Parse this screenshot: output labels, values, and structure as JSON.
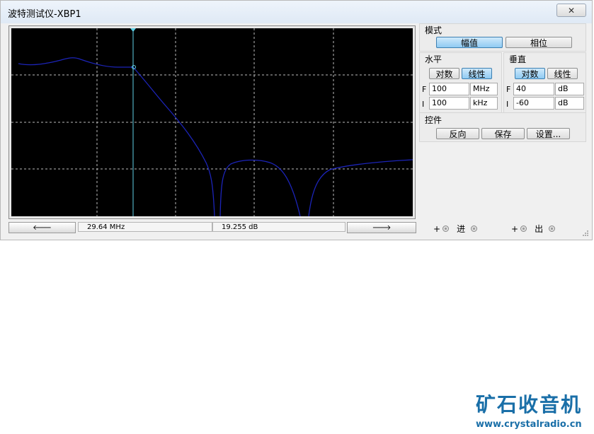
{
  "window": {
    "title": "波特测试仪-XBP1",
    "close_label": "✕"
  },
  "readout": {
    "frequency": "29.64 MHz",
    "magnitude": "19.255 dB",
    "left_arrow": "🡐",
    "right_arrow": "🡒"
  },
  "mode": {
    "header": "模式",
    "magnitude_label": "幅值",
    "phase_label": "相位",
    "active": "magnitude"
  },
  "horizontal": {
    "header": "水平",
    "log_label": "对数",
    "lin_label": "线性",
    "active": "lin",
    "final_label": "F",
    "final_value": "100",
    "final_unit": "MHz",
    "initial_label": "I",
    "initial_value": "100",
    "initial_unit": "kHz"
  },
  "vertical": {
    "header": "垂直",
    "log_label": "对数",
    "lin_label": "线性",
    "active": "log",
    "final_label": "F",
    "final_value": "40",
    "final_unit": "dB",
    "initial_label": "I",
    "initial_value": "-60",
    "initial_unit": "dB"
  },
  "controls": {
    "header": "控件",
    "reverse_label": "反向",
    "save_label": "保存",
    "setup_label": "设置..."
  },
  "terminals": {
    "in_plus": "+",
    "in_label": "进",
    "out_plus": "+",
    "out_label": "出"
  },
  "watermark": {
    "main": "矿石收音机",
    "url": "www.crystalradio.cn"
  },
  "colors": {
    "trace": "#1c24b8",
    "cursor": "#5fd0e6",
    "grid": "#bcbcbc",
    "plot_bg": "#000000",
    "accent": "#8fcaf2"
  }
}
